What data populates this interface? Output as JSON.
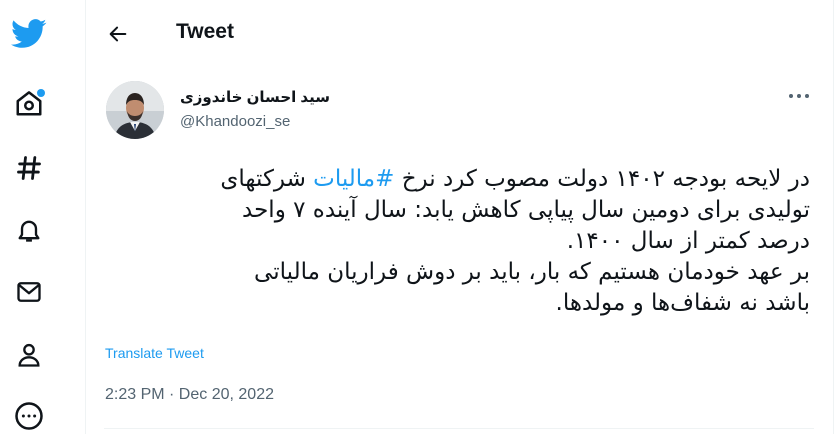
{
  "nav": {
    "items": [
      {
        "icon": "twitter-logo-icon",
        "label": ""
      },
      {
        "icon": "home-icon",
        "label": ""
      },
      {
        "icon": "hashtag-icon",
        "label": ""
      },
      {
        "icon": "bell-icon",
        "label": ""
      },
      {
        "icon": "mail-icon",
        "label": ""
      },
      {
        "icon": "profile-icon",
        "label": ""
      },
      {
        "icon": "more-circle-icon",
        "label": ""
      }
    ]
  },
  "header": {
    "title": "Tweet"
  },
  "tweet": {
    "author_name": "سید احسان خاندوزی",
    "author_handle": "@Khandoozi_se",
    "text_lines": {
      "l1_before": "در لایحه بودجه ۱۴۰۲ دولت مصوب کرد نرخ ",
      "l1_hashtag": "#مالیات",
      "l1_after": " شرکتهای",
      "l2": "تولیدی برای دومین سال پیاپی کاهش یابد: سال آینده ۷ واحد",
      "l3": "درصد کمتر از سال ۱۴۰۰.",
      "l4": "بر عهد خودمان هستیم که بار، باید بر دوش فراریان مالیاتی",
      "l5": "باشد نه شفاف‌ها و مولدها."
    },
    "translate_label": "Translate Tweet",
    "timestamp": "2:23 PM · Dec 20, 2022"
  },
  "colors": {
    "accent": "#1d9bf0",
    "text": "#0f1419",
    "secondary": "#536471",
    "divider": "#eff3f4"
  }
}
